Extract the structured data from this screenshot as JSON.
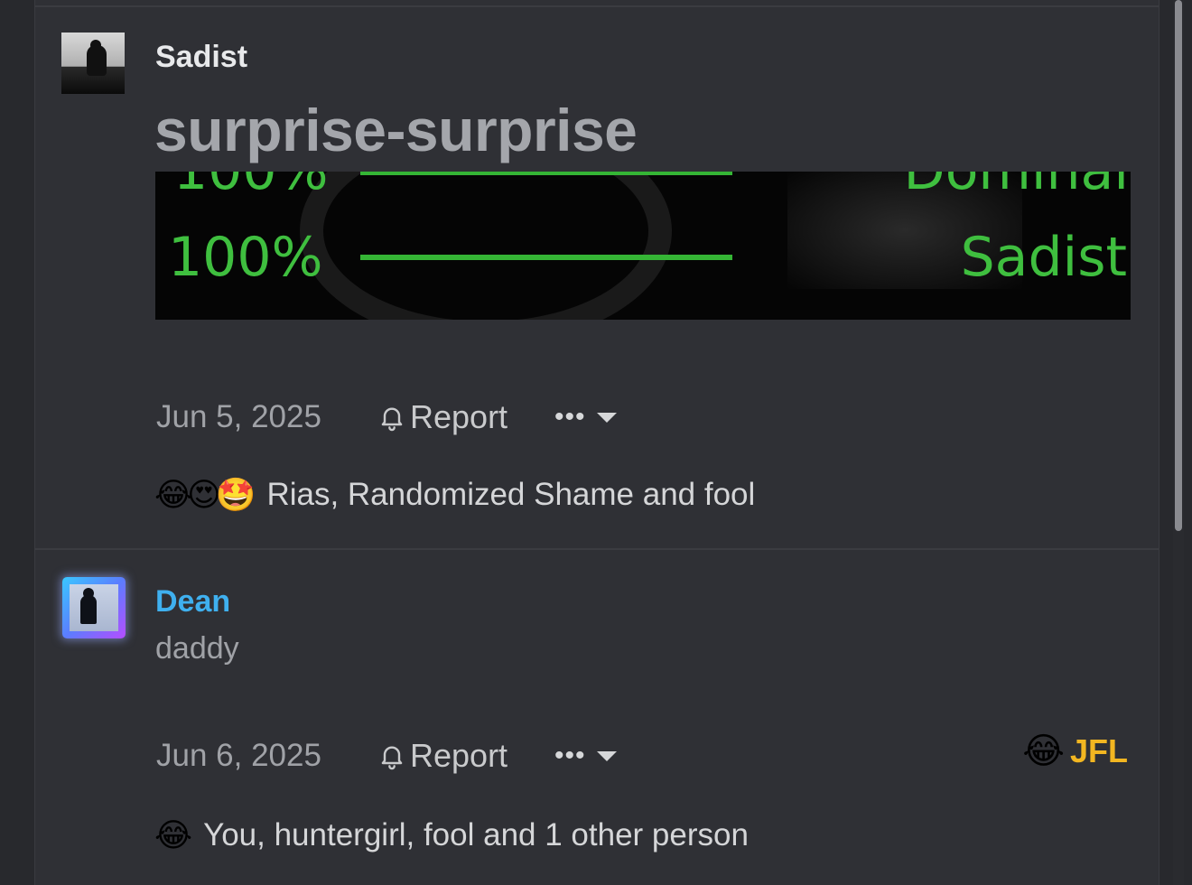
{
  "posts": [
    {
      "author": "Sadist",
      "title": "surprise-surprise",
      "embed": {
        "pct_cut": "100%",
        "pct": "100%",
        "word_cut": "Dominai",
        "word": "Sadist"
      },
      "date": "Jun 5, 2025",
      "report_label": "Report",
      "more_label": "•••",
      "reaction_emojis": [
        "😂",
        "😍",
        "🤩"
      ],
      "reaction_summary": "Rias, Randomized Shame and fool"
    },
    {
      "author": "Dean",
      "text": "daddy",
      "date": "Jun 6, 2025",
      "report_label": "Report",
      "more_label": "•••",
      "badge": {
        "emoji": "😂",
        "label": "JFL"
      },
      "reaction_emojis": [
        "😂"
      ],
      "reaction_summary": "You, huntergirl, fool and 1 other person"
    }
  ],
  "colors": {
    "background": "#28292d",
    "panel": "#2f3035",
    "username_highlight": "#3fb0ef",
    "badge_text": "#f2b621",
    "graphic_green": "#3fbf3f"
  },
  "icons": {
    "report": "bell-icon",
    "more": "dots-icon",
    "dropdown": "caret-down-icon"
  }
}
